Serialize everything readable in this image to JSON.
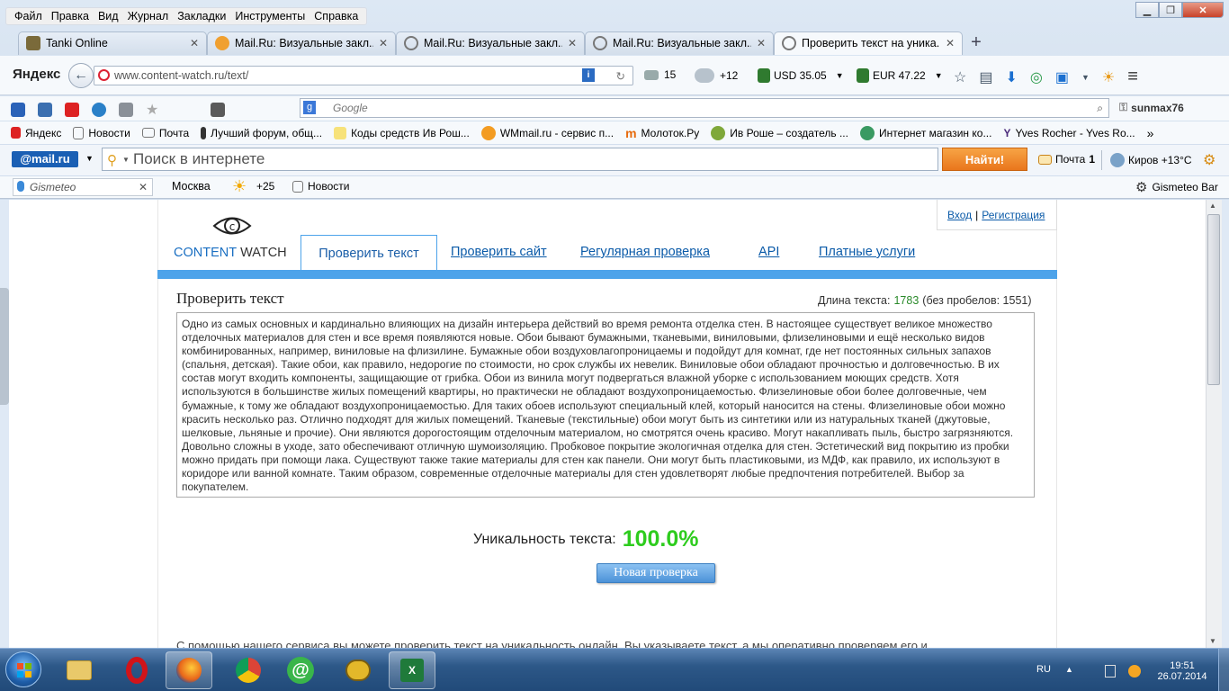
{
  "menu": [
    "Файл",
    "Правка",
    "Вид",
    "Журнал",
    "Закладки",
    "Инструменты",
    "Справка"
  ],
  "tabs": [
    {
      "title": "Tanki Online"
    },
    {
      "title": "Mail.Ru: Визуальные закл..."
    },
    {
      "title": "Mail.Ru: Визуальные закл..."
    },
    {
      "title": "Mail.Ru: Визуальные закл..."
    },
    {
      "title": "Проверить текст на уника..."
    }
  ],
  "nav": {
    "yandex": "Яндекс",
    "url": "www.content-watch.ru/text/",
    "mail_count": "15",
    "weather": "+12",
    "usd": "USD 35.05",
    "eur": "EUR 47.22"
  },
  "google": {
    "placeholder": "Google",
    "user": "sunmax76"
  },
  "bookmarks": [
    "Яндекс",
    "Новости",
    "Почта",
    "Лучший форум, общ...",
    "Коды средств Ив Рош...",
    "WMmail.ru - сервис п...",
    "Молоток.Ру",
    "Ив Роше – создатель ...",
    "Интернет магазин ко...",
    "Yves Rocher - Yves Ro..."
  ],
  "mailru": {
    "logo": "@mail.ru",
    "search_placeholder": "Поиск в интернете",
    "find": "Найти!",
    "mail": "Почта",
    "mail_count": "1",
    "weather": "Киров +13°C"
  },
  "gismeteo": {
    "field": "Gismeteo",
    "city": "Москва",
    "temp": "+25",
    "news": "Новости",
    "bar": "Gismeteo Bar"
  },
  "site": {
    "login": "Вход",
    "sep": "|",
    "register": "Регистрация",
    "logo_content": "CONTENT",
    "logo_watch": "WATCH",
    "nav_active": "Проверить текст",
    "nav": [
      "Проверить сайт",
      "Регулярная проверка",
      "API",
      "Платные услуги"
    ],
    "heading": "Проверить текст",
    "length_label": "Длина текста:",
    "length_value": "1783",
    "length_suffix": "(без пробелов: 1551)",
    "text": "Одно из самых основных и кардинально влияющих на дизайн интерьера действий во время ремонта отделка стен. В настоящее существует великое множество отделочных материалов для стен и все время появляются новые. Обои бывают бумажными, тканевыми, виниловыми, флизелиновыми и ещё несколько видов комбинированных, например, виниловые на флизилине. Бумажные обои воздуховлагопроницаемы и подойдут для комнат, где нет постоянных сильных запахов (спальня, детская). Такие обои, как правило, недорогие по стоимости, но срок службы их невелик. Виниловые обои обладают прочностью и долговечностью. В их состав могут входить компоненты, защищающие от грибка. Обои из винила могут подвергаться влажной уборке с использованием моющих средств. Хотя используются в большинстве жилых помещений квартиры, но практически не обладают воздухопроницаемостью. Флизелиновые обои более долговечные, чем бумажные, к тому же обладают воздухопроницаемостью. Для таких обоев используют специальный клей, который наносится на стены. Флизелиновые обои можно красить несколько раз. Отлично подходят для жилых помещений. Тканевые (текстильные) обои могут быть из синтетики или из натуральных тканей (джутовые, шелковые, льняные и прочие). Они являются дорогостоящим отделочным материалом, но смотрятся очень красиво. Могут накапливать пыль, быстро загрязняются. Довольно сложны в уходе, зато обеспечивают отличную шумоизоляцию. Пробковое покрытие экологичная отделка для стен. Эстетический вид покрытию из пробки можно придать при помощи лака. Существуют также такие материалы для стен как панели. Они могут быть пластиковыми, из МДФ, как правило, их используют в коридоре или ванной комнате. Таким образом, современные отделочные материалы для стен удовлетворят любые предпочтения потребителей. Выбор за покупателем.",
    "uniq_label": "Уникальность текста:",
    "uniq_value": "100.0%",
    "new_check": "Новая проверка",
    "footer_text": "С помощью нашего сервиса вы можете проверить текст на уникальность онлайн. Вы указываете текст, а мы оперативно проверяем его и"
  },
  "taskbar": {
    "lang": "RU",
    "time": "19:51",
    "date": "26.07.2014"
  },
  "colors": {
    "accent": "#4da3ea",
    "link": "#0a5aa8",
    "uniq": "#2ecc1e",
    "find": "#ee7d1e"
  }
}
